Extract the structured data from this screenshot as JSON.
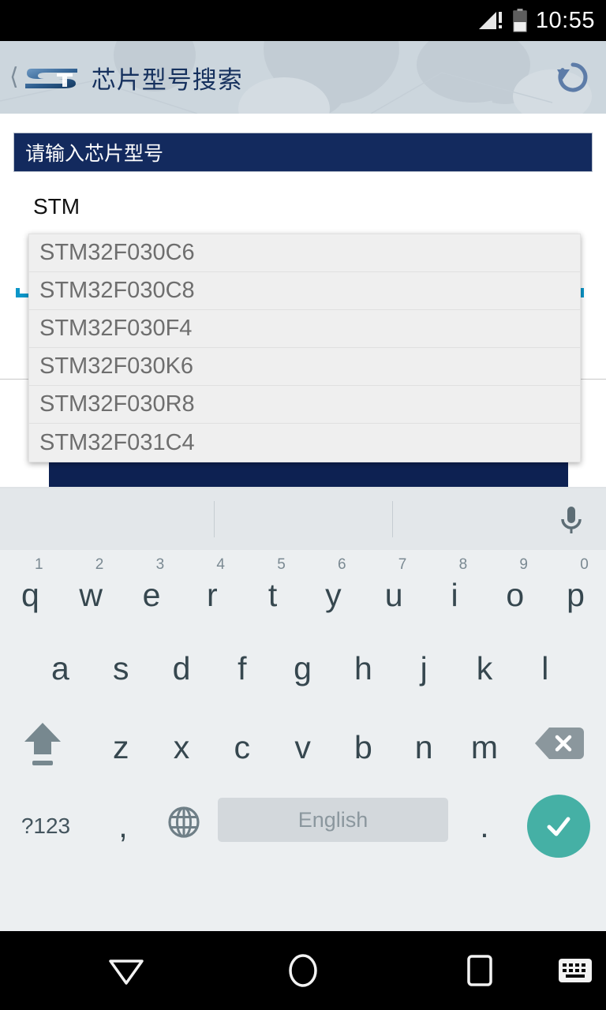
{
  "status_bar": {
    "time": "10:55",
    "signal_icon": "signal-no-sim-icon",
    "battery_icon": "battery-icon",
    "battery_level_percent": 40
  },
  "header": {
    "back_icon": "back-chevron-icon",
    "logo_icon": "st-logo-icon",
    "title": "芯片型号搜索",
    "refresh_icon": "refresh-icon",
    "background_color": "#ccd6dd",
    "title_color": "#16315e"
  },
  "form": {
    "label": "请输入芯片型号",
    "label_background": "#132a5e",
    "input_value": "STM",
    "input_placeholder": "",
    "underline_color": "#0c96c8",
    "submit_color": "#0d2152"
  },
  "suggestions": {
    "items": [
      {
        "label": "STM32F030C6"
      },
      {
        "label": "STM32F030C8"
      },
      {
        "label": "STM32F030F4"
      },
      {
        "label": "STM32F030K6"
      },
      {
        "label": "STM32F030R8"
      },
      {
        "label": "STM32F031C4"
      }
    ],
    "background": "#efefef",
    "text_color": "#6e6e6e"
  },
  "keyboard": {
    "suggestion_strip": {
      "mic_icon": "microphone-icon"
    },
    "row1": [
      {
        "key": "q",
        "num": "1"
      },
      {
        "key": "w",
        "num": "2"
      },
      {
        "key": "e",
        "num": "3"
      },
      {
        "key": "r",
        "num": "4"
      },
      {
        "key": "t",
        "num": "5"
      },
      {
        "key": "y",
        "num": "6"
      },
      {
        "key": "u",
        "num": "7"
      },
      {
        "key": "i",
        "num": "8"
      },
      {
        "key": "o",
        "num": "9"
      },
      {
        "key": "p",
        "num": "0"
      }
    ],
    "row2": [
      {
        "key": "a"
      },
      {
        "key": "s"
      },
      {
        "key": "d"
      },
      {
        "key": "f"
      },
      {
        "key": "g"
      },
      {
        "key": "h"
      },
      {
        "key": "j"
      },
      {
        "key": "k"
      },
      {
        "key": "l"
      }
    ],
    "row3": [
      {
        "key": "z"
      },
      {
        "key": "x"
      },
      {
        "key": "c"
      },
      {
        "key": "v"
      },
      {
        "key": "b"
      },
      {
        "key": "n"
      },
      {
        "key": "m"
      }
    ],
    "shift_icon": "shift-icon",
    "backspace_icon": "backspace-icon",
    "symbols_label": "?123",
    "comma_label": ",",
    "language_icon": "globe-icon",
    "space_label": "English",
    "period_label": ".",
    "enter_icon": "check-icon",
    "enter_color": "#45b0a5"
  },
  "nav_bar": {
    "back_icon": "nav-back-triangle-icon",
    "home_icon": "nav-home-circle-icon",
    "recents_icon": "nav-recents-square-icon",
    "keyboard_icon": "nav-keyboard-icon"
  }
}
